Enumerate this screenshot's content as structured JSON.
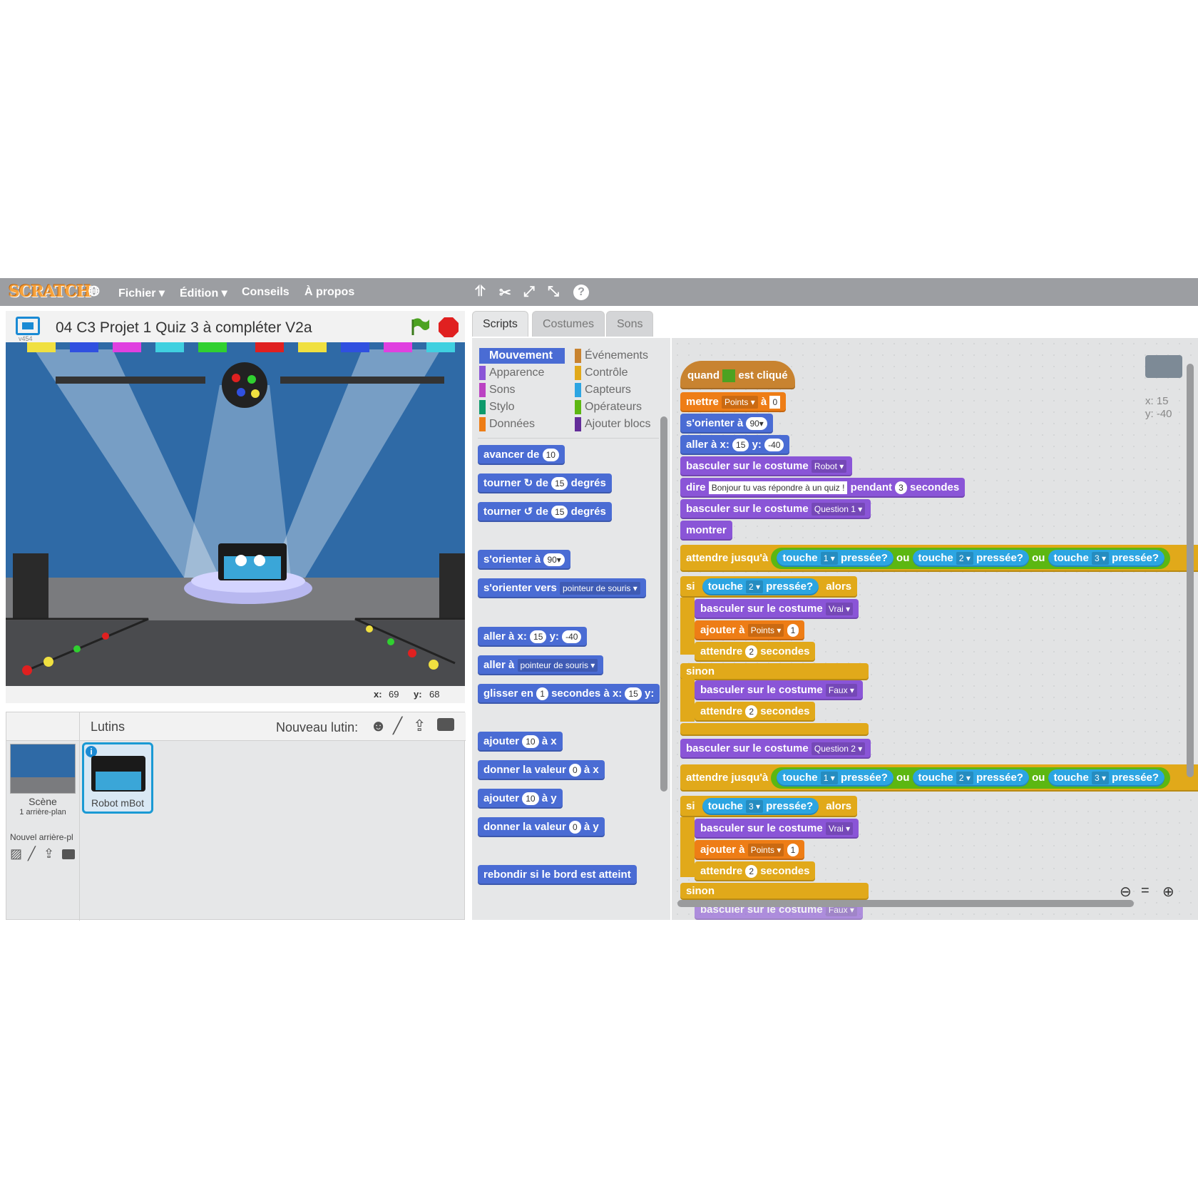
{
  "menubar": {
    "logo": "SCRATCH",
    "items": [
      "Fichier ▾",
      "Édition ▾",
      "Conseils",
      "À propos"
    ]
  },
  "stage": {
    "title": "04 C3 Projet 1 Quiz 3 à compléter V2a",
    "version": "v454",
    "mouse_x_label": "x:",
    "mouse_x": "69",
    "mouse_y_label": "y:",
    "mouse_y": "68"
  },
  "sprites": {
    "header": "Lutins",
    "new_sprite": "Nouveau lutin:",
    "scene_label": "Scène",
    "scene_sub": "1 arrière-plan",
    "new_backdrop": "Nouvel arrière-pl",
    "selected_sprite": "Robot mBot"
  },
  "tabs": [
    "Scripts",
    "Costumes",
    "Sons"
  ],
  "categories": {
    "left": [
      "Mouvement",
      "Apparence",
      "Sons",
      "Stylo",
      "Données"
    ],
    "right": [
      "Événements",
      "Contrôle",
      "Capteurs",
      "Opérateurs",
      "Ajouter blocs"
    ],
    "colors": {
      "Mouvement": "#4a6cd4",
      "Apparence": "#8a55d7",
      "Sons": "#bb42c3",
      "Stylo": "#0e9a6c",
      "Données": "#ee7d16",
      "Événements": "#c88330",
      "Contrôle": "#e1a91a",
      "Capteurs": "#2ca5e2",
      "Opérateurs": "#5cb712",
      "Ajouter blocs": "#632d99"
    }
  },
  "palette_blocks": {
    "b1": "avancer de",
    "b1n": "10",
    "b2a": "tourner ↻ de",
    "b2n": "15",
    "b2b": "degrés",
    "b3a": "tourner ↺ de",
    "b3n": "15",
    "b3b": "degrés",
    "b4": "s'orienter à",
    "b4n": "90▾",
    "b5": "s'orienter vers",
    "b5d": "pointeur de souris ▾",
    "b6a": "aller à x:",
    "b6x": "15",
    "b6b": "y:",
    "b6y": "-40",
    "b7": "aller à",
    "b7d": "pointeur de souris ▾",
    "b8a": "glisser en",
    "b8n": "1",
    "b8b": "secondes à x:",
    "b8x": "15",
    "b8c": "y:",
    "b9a": "ajouter",
    "b9n": "10",
    "b9b": "à x",
    "b10a": "donner la valeur",
    "b10n": "0",
    "b10b": "à x",
    "b11a": "ajouter",
    "b11n": "10",
    "b11b": "à y",
    "b12a": "donner la valeur",
    "b12n": "0",
    "b12b": "à y",
    "b13": "rebondir si le bord est atteint"
  },
  "script": {
    "hat_a": "quand",
    "hat_b": "est cliqué",
    "set_a": "mettre",
    "set_var": "Points ▾",
    "set_b": "à",
    "set_val": "0",
    "orient": "s'orienter à",
    "orient_v": "90▾",
    "goto_a": "aller à x:",
    "goto_x": "15",
    "goto_b": "y:",
    "goto_y": "-40",
    "costume": "basculer sur le costume",
    "c_robot": "Robot ▾",
    "say_a": "dire",
    "say_txt": "Bonjour tu vas répondre à un quiz !",
    "say_b": "pendant",
    "say_n": "3",
    "say_c": "secondes",
    "c_q1": "Question 1 ▾",
    "show": "montrer",
    "wait_until": "attendre jusqu'à",
    "key": "touche",
    "pressed": "pressée?",
    "or": "ou",
    "k1": "1 ▾",
    "k2": "2 ▾",
    "k3": "3 ▾",
    "if": "si",
    "then": "alors",
    "else": "sinon",
    "c_vrai": "Vrai ▾",
    "c_faux": "Faux ▾",
    "add": "ajouter à",
    "add_var": "Points ▾",
    "add_n": "1",
    "wait_a": "attendre",
    "wait_n": "2",
    "wait_b": "secondes",
    "c_q2": "Question 2 ▾",
    "sprite_x": "x: 15",
    "sprite_y": "y: -40"
  }
}
